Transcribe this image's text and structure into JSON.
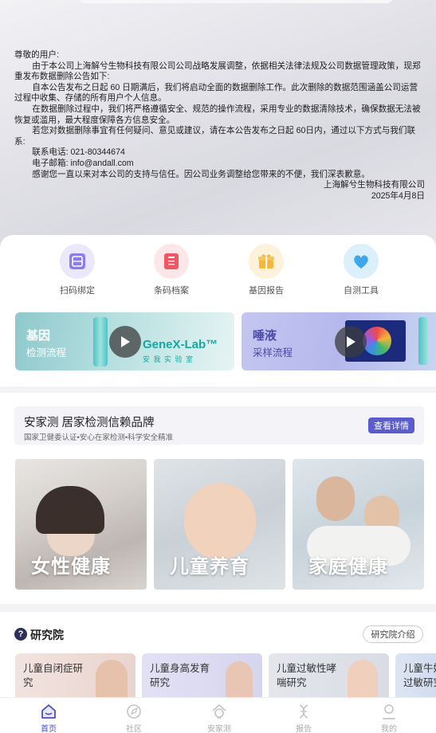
{
  "notice": {
    "greeting": "尊敬的用户:",
    "para1": "由于本公司上海解兮生物科技有限公司公司战略发展调整，依据相关法律法规及公司数据管理政策，现郑重发布数据删除公告如下:",
    "para2": "自本公告发布之日起 60 日期满后，我们将启动全面的数据删除工作。此次删除的数据范围涵盖公司运营过程中收集、存储的所有用户个人信息。",
    "para3": "在数据删除过程中，我们将严格遵循安全、规范的操作流程，采用专业的数据清除技术，确保数据无法被恢复或滥用，最大程度保障各方信息安全。",
    "para4": "若您对数据删除事宜有任何疑问、意见或建议，请在本公告发布之日起 60日内，通过以下方式与我们联系:",
    "phone": "联系电话:  021-80344674",
    "email": "电子邮箱:  info@andall.com",
    "para5": "感谢您一直以来对本公司的支持与信任。因公司业务调整给您带来的不便，我们深表歉意。",
    "company": "上海解兮生物科技有限公司",
    "date": "2025年4月8日"
  },
  "quick_icons": [
    {
      "label": "扫码绑定",
      "icon": "scan-bind-icon",
      "color": "#7b6cf0"
    },
    {
      "label": "条码档案",
      "icon": "barcode-archive-icon",
      "color": "#f0505e"
    },
    {
      "label": "基因报告",
      "icon": "gene-report-icon",
      "color": "#f3b53a"
    },
    {
      "label": "自测工具",
      "icon": "self-test-icon",
      "color": "#3aa3e8"
    }
  ],
  "video_cards": [
    {
      "title": "基因",
      "subtitle": "检测流程",
      "brand": "GeneX-Lab™",
      "brand_sub": "安 我 实 验 室"
    },
    {
      "title": "唾液",
      "subtitle": "采样流程"
    }
  ],
  "brand": {
    "title": "安家测 居家检测信赖品牌",
    "subtitle": "国家卫健委认证•安心在家检测•科学安全精准",
    "button": "查看详情"
  },
  "categories": [
    {
      "label": "女性健康"
    },
    {
      "label": "儿童养育"
    },
    {
      "label": "家庭健康"
    }
  ],
  "research": {
    "title": "研究院",
    "link": "研究院介绍",
    "cards": [
      {
        "label": "儿童自闭症研究"
      },
      {
        "label": "儿童身高发育研究"
      },
      {
        "label": "儿童过敏性哮喘研究"
      },
      {
        "label": "儿童牛奶过敏研究"
      }
    ]
  },
  "nav": [
    {
      "label": "首页",
      "icon": "home-icon",
      "active": true
    },
    {
      "label": "社区",
      "icon": "community-icon",
      "active": false
    },
    {
      "label": "安家测",
      "icon": "home-test-icon",
      "active": false
    },
    {
      "label": "报告",
      "icon": "report-icon",
      "active": false
    },
    {
      "label": "我的",
      "icon": "profile-icon",
      "active": false
    }
  ],
  "colors": {
    "accent": "#5a5ccc",
    "nav_active": "#4b4fc0"
  }
}
